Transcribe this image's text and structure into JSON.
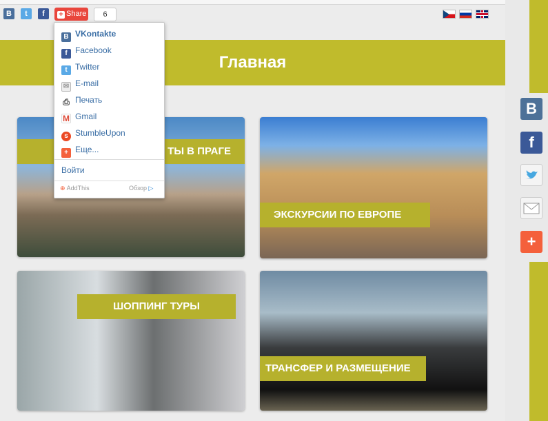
{
  "share_bar": {
    "share_label": "Share",
    "share_count": "6",
    "icons": [
      "vk-icon",
      "twitter-icon",
      "facebook-icon"
    ]
  },
  "flags": [
    "czech-flag-icon",
    "russian-flag-icon",
    "uk-flag-icon"
  ],
  "header": {
    "title": "Главная"
  },
  "tiles": [
    {
      "label": "ТЫ В ПРАГЕ"
    },
    {
      "label": "ЭКСКУРСИИ ПО ЕВРОПЕ"
    },
    {
      "label": "ШОППИНГ ТУРЫ"
    },
    {
      "label": "ТРАНСФЕР И РАЗМЕЩЕНИЕ"
    }
  ],
  "share_menu": {
    "items": [
      {
        "label": "VKontakte",
        "icon": "vk-icon",
        "color": "#4a6f9c"
      },
      {
        "label": "Facebook",
        "icon": "facebook-icon",
        "color": "#3b5998"
      },
      {
        "label": "Twitter",
        "icon": "twitter-icon",
        "color": "#5aa9e6"
      },
      {
        "label": "E-mail",
        "icon": "mail-icon",
        "color": "#dddddd"
      },
      {
        "label": "Печать",
        "icon": "print-icon",
        "color": "#444444"
      },
      {
        "label": "Gmail",
        "icon": "gmail-icon",
        "color": "#dd4b39"
      },
      {
        "label": "StumbleUpon",
        "icon": "stumbleupon-icon",
        "color": "#eb4924"
      },
      {
        "label": "Еще...",
        "icon": "more-icon",
        "color": "#f4603b"
      }
    ],
    "login_label": "Войти",
    "footer_brand": "AddThis",
    "footer_link": "Обзор"
  },
  "side_share": [
    "vk-icon",
    "facebook-icon",
    "twitter-icon",
    "mail-icon",
    "more-icon"
  ],
  "colors": {
    "accent": "#c0bb2c",
    "share_red": "#e9463c"
  }
}
